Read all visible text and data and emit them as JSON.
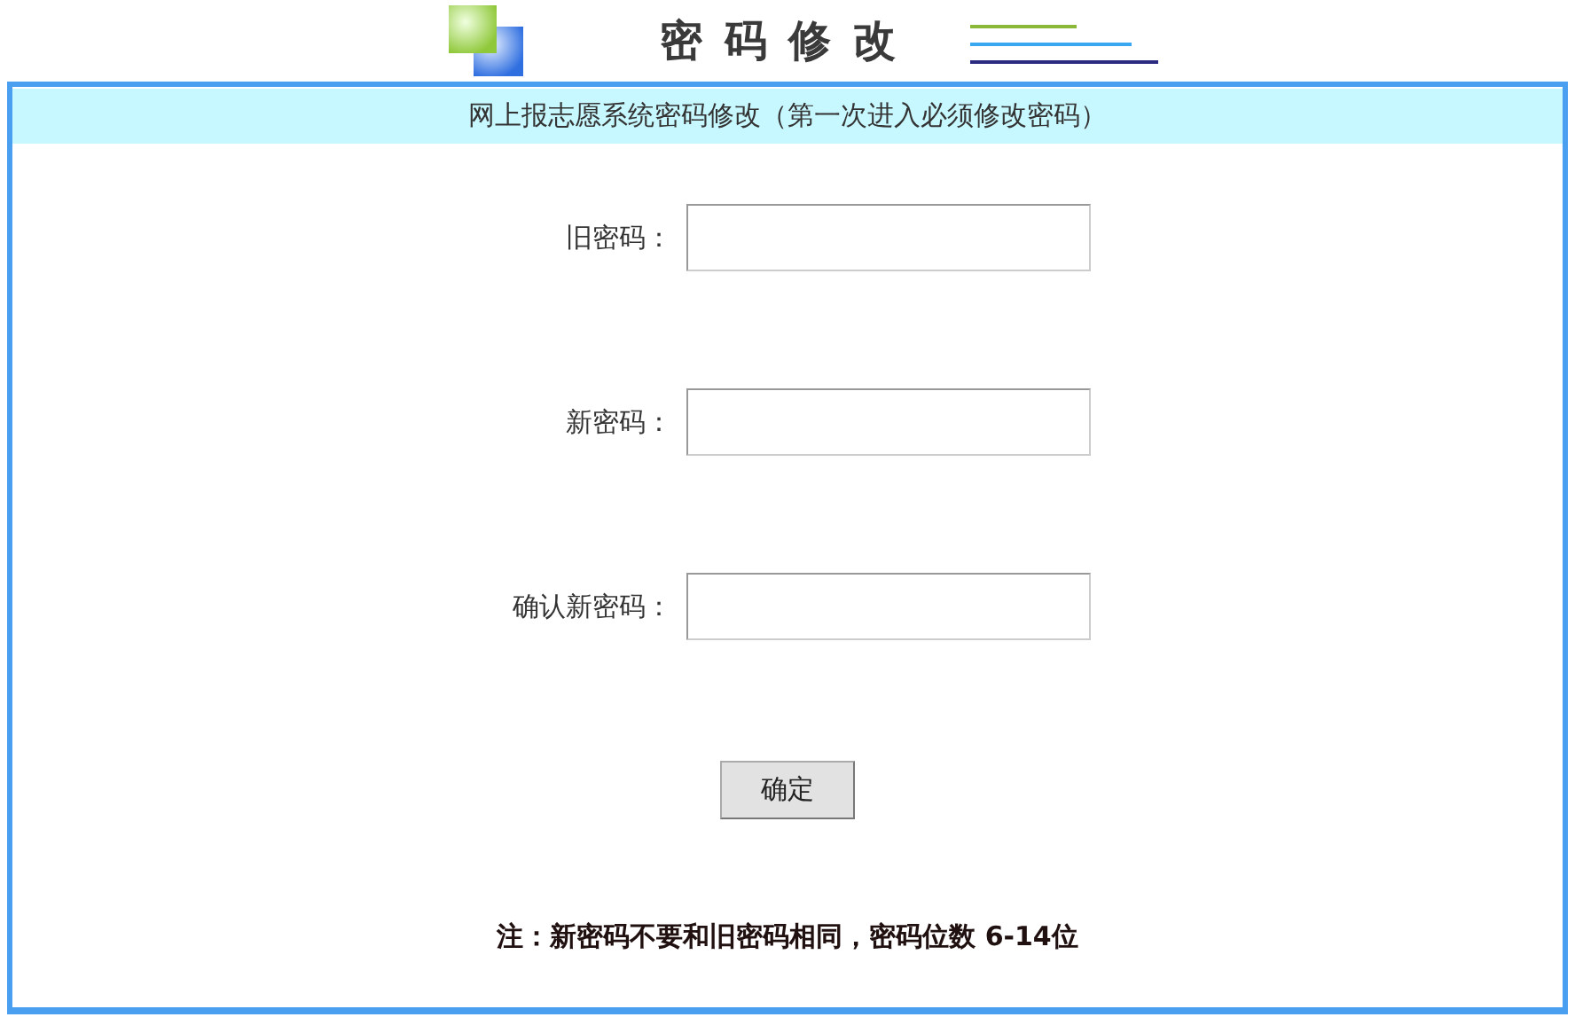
{
  "header": {
    "title": "密 码 修 改"
  },
  "panel": {
    "subtitle": "网上报志愿系统密码修改（第一次进入必须修改密码）",
    "fields": [
      {
        "label": "旧密码："
      },
      {
        "label": "新密码："
      },
      {
        "label": "确认新密码："
      }
    ],
    "buttons": [
      "确定"
    ],
    "note": "注：新密码不要和旧密码相同，密码位数 6-14位"
  }
}
